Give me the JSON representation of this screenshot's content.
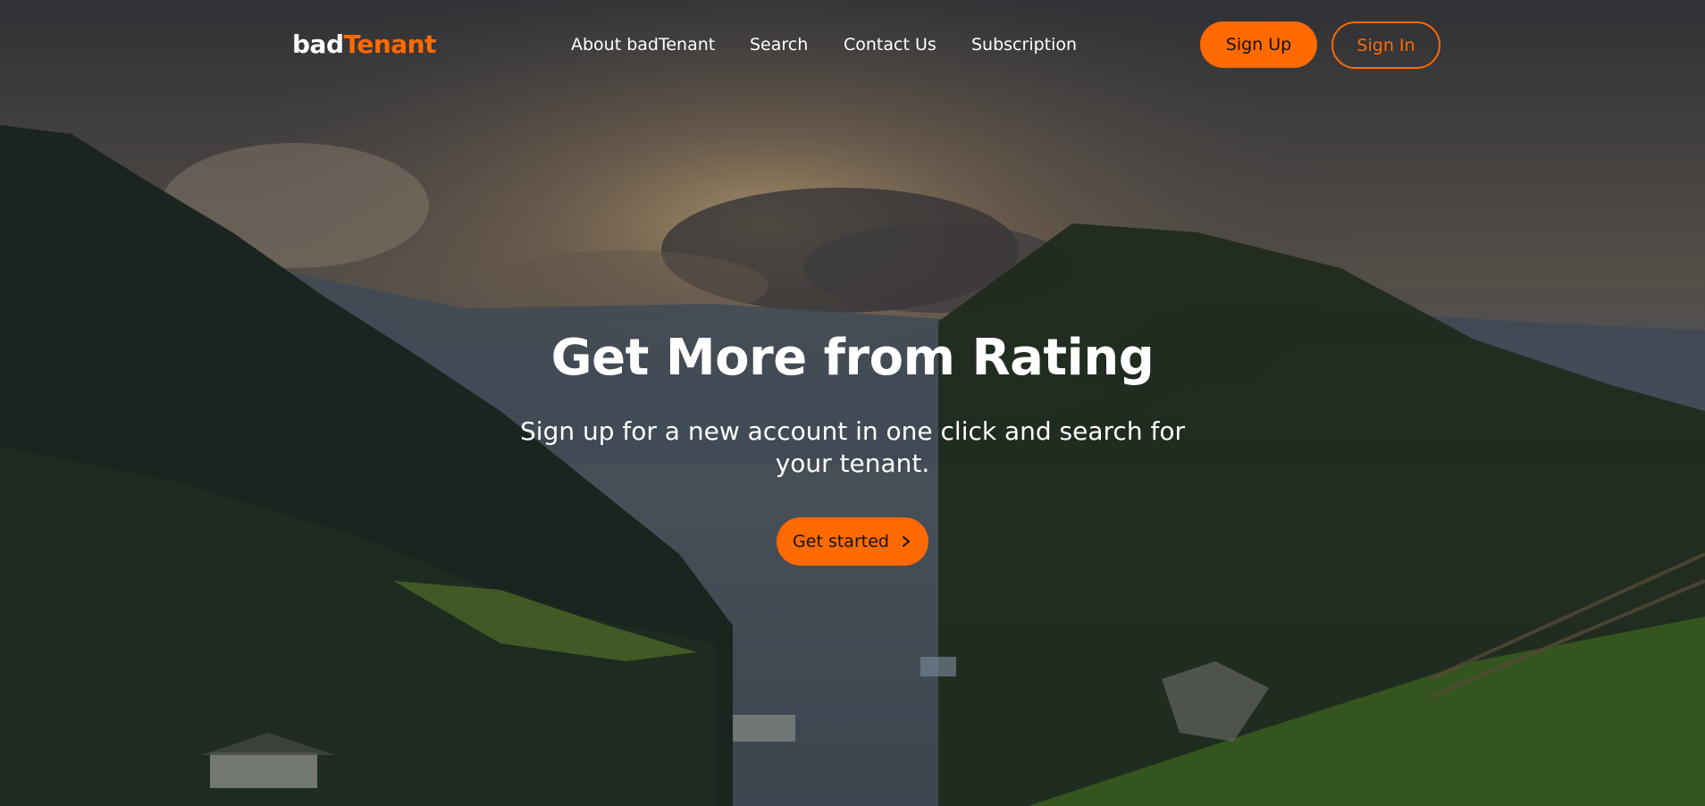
{
  "brand": {
    "logo_part1": "bad",
    "logo_part2": "Tenant",
    "accent_color": "#ff6a00"
  },
  "nav": {
    "items": [
      {
        "label": "About badTenant"
      },
      {
        "label": "Search"
      },
      {
        "label": "Contact Us"
      },
      {
        "label": "Subscription"
      }
    ]
  },
  "auth": {
    "signup_label": "Sign Up",
    "signin_label": "Sign In"
  },
  "hero": {
    "headline": "Get More from Rating",
    "subheadline": "Sign up for a new account in one click and search for your tenant.",
    "cta_label": "Get started",
    "cta_icon": "chevron-right-icon",
    "background": "mountain-valley-sunset-photo"
  }
}
